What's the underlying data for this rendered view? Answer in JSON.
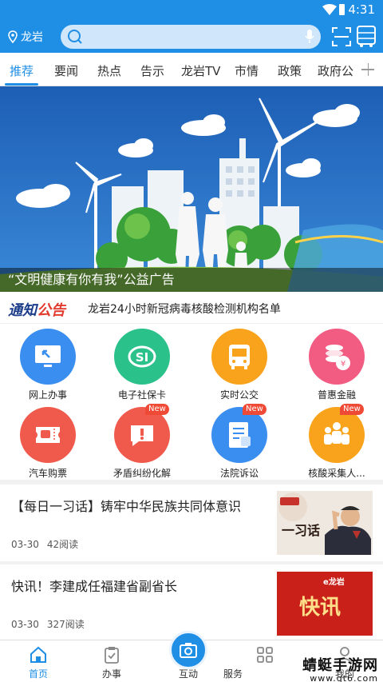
{
  "status": {
    "time": "4:31"
  },
  "header": {
    "location": "龙岩",
    "search_placeholder": ""
  },
  "tabs": [
    "推荐",
    "要闻",
    "热点",
    "告示",
    "龙岩TV",
    "市情",
    "政策",
    "政府公"
  ],
  "banner": {
    "caption": "“文明健康有你有我”公益广告"
  },
  "notice": {
    "logo_a": "通知",
    "logo_b": "公告",
    "text": "龙岩24小时新冠病毒核酸检测机构名单"
  },
  "services": [
    {
      "label": "网上办事",
      "icon": "monitor-icon",
      "color": "#3a8ef0",
      "badge": ""
    },
    {
      "label": "电子社保卡",
      "icon": "social-security-icon",
      "color": "#2bc18a",
      "badge": ""
    },
    {
      "label": "实时公交",
      "icon": "bus-icon",
      "color": "#f9a31c",
      "badge": ""
    },
    {
      "label": "普惠金融",
      "icon": "coins-icon",
      "color": "#f25c82",
      "badge": ""
    },
    {
      "label": "汽车购票",
      "icon": "ticket-icon",
      "color": "#ef5a4d",
      "badge": ""
    },
    {
      "label": "矛盾纠纷化解",
      "icon": "chat-alert-icon",
      "color": "#ef5a4d",
      "badge": "New"
    },
    {
      "label": "法院诉讼",
      "icon": "document-icon",
      "color": "#3a8ef0",
      "badge": "New"
    },
    {
      "label": "核酸采集人...",
      "icon": "people-icon",
      "color": "#f9a31c",
      "badge": "New"
    }
  ],
  "news": [
    {
      "title": "【每日一习话】铸牢中华民族共同体意识",
      "date": "03-30",
      "reads": "42阅读",
      "thumb_text": "一习话"
    },
    {
      "title": "快讯！李建成任福建省副省长",
      "date": "03-30",
      "reads": "327阅读",
      "thumb_text": "快讯",
      "thumb_tag": "e龙岩"
    }
  ],
  "bottom_nav": [
    "首页",
    "办事",
    "互动",
    "服务",
    "我的"
  ],
  "watermark": {
    "main": "蜻蜓手游网",
    "sub": "www.qt6.com"
  }
}
